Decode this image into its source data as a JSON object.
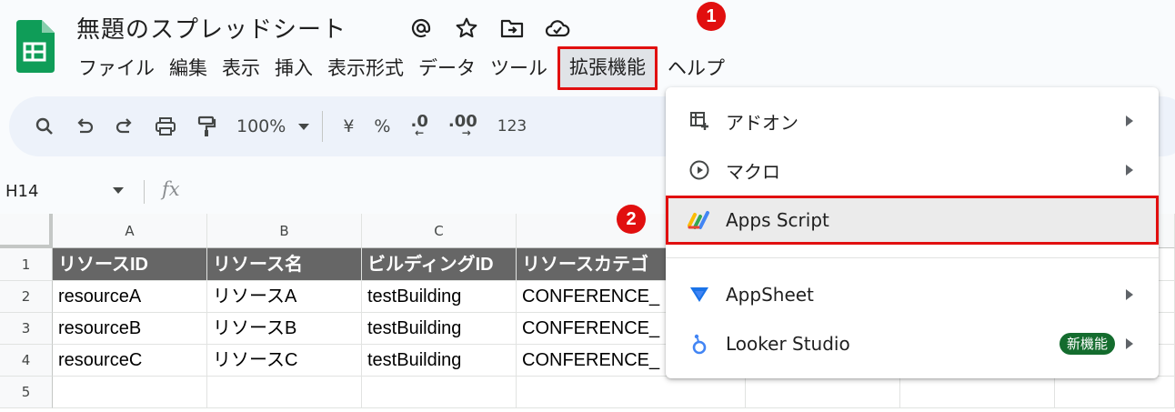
{
  "document": {
    "title": "無題のスプレッドシート"
  },
  "menubar": {
    "items": [
      "ファイル",
      "編集",
      "表示",
      "挿入",
      "表示形式",
      "データ",
      "ツール",
      "拡張機能",
      "ヘルプ"
    ]
  },
  "toolbar": {
    "zoom": "100%",
    "currency": "¥",
    "percent": "%",
    "decrease_decimal": ".0",
    "increase_decimal": ".00",
    "number_format": "123"
  },
  "formula_bar": {
    "cell_ref": "H14",
    "fx": "fx"
  },
  "grid": {
    "columns": [
      "A",
      "B",
      "C"
    ],
    "rows": [
      "1",
      "2",
      "3",
      "4",
      "5"
    ],
    "header_row": [
      "リソースID",
      "リソース名",
      "ビルディングID",
      "リソースカテゴ"
    ],
    "data": [
      [
        "resourceA",
        "リソースA",
        "testBuilding",
        "CONFERENCE_"
      ],
      [
        "resourceB",
        "リソースB",
        "testBuilding",
        "CONFERENCE_"
      ],
      [
        "resourceC",
        "リソースC",
        "testBuilding",
        "CONFERENCE_"
      ]
    ]
  },
  "extensions_menu": {
    "items": [
      {
        "label": "アドオン",
        "icon": "addon-icon"
      },
      {
        "label": "マクロ",
        "icon": "macro-play-icon"
      },
      {
        "label": "Apps Script",
        "icon": "apps-script-icon"
      },
      {
        "label": "AppSheet",
        "icon": "appsheet-icon"
      },
      {
        "label": "Looker Studio",
        "icon": "looker-studio-icon",
        "badge": "新機能"
      }
    ]
  },
  "annotations": {
    "step1": "1",
    "step2": "2"
  },
  "colors": {
    "highlight": "#e10f0f",
    "header_fill": "#666666",
    "sheets_green": "#0f9d58",
    "badge_green": "#146c2e"
  }
}
